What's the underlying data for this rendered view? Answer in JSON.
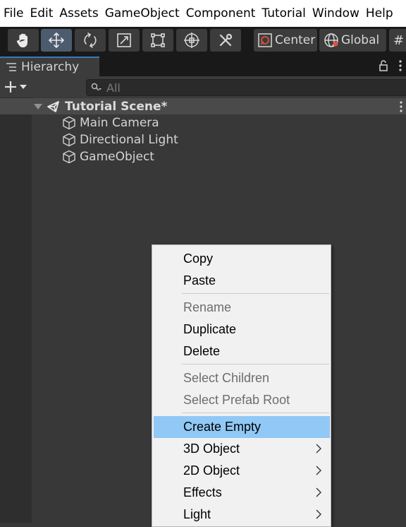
{
  "menubar": {
    "items": [
      "File",
      "Edit",
      "Assets",
      "GameObject",
      "Component",
      "Tutorial",
      "Window",
      "Help"
    ]
  },
  "toolbar": {
    "tools": [
      "hand-tool",
      "move-tool",
      "rotate-tool",
      "scale-tool",
      "rect-tool",
      "transform-tool",
      "custom-tool"
    ],
    "active_tool": "move-tool",
    "pivot_label": "Center",
    "space_label": "Global"
  },
  "hierarchy": {
    "tab_label": "Hierarchy",
    "search_placeholder": "All",
    "scene_name": "Tutorial Scene*",
    "items": [
      "Main Camera",
      "Directional Light",
      "GameObject"
    ]
  },
  "context_menu": {
    "items": [
      {
        "label": "Copy",
        "enabled": true
      },
      {
        "label": "Paste",
        "enabled": true
      },
      {
        "label": "Rename",
        "enabled": false
      },
      {
        "label": "Duplicate",
        "enabled": true
      },
      {
        "label": "Delete",
        "enabled": true
      },
      {
        "label": "Select Children",
        "enabled": false
      },
      {
        "label": "Select Prefab Root",
        "enabled": false
      },
      {
        "label": "Create Empty",
        "enabled": true,
        "highlighted": true
      },
      {
        "label": "3D Object",
        "enabled": true,
        "submenu": true
      },
      {
        "label": "2D Object",
        "enabled": true,
        "submenu": true
      },
      {
        "label": "Effects",
        "enabled": true,
        "submenu": true
      },
      {
        "label": "Light",
        "enabled": true,
        "submenu": true
      }
    ]
  },
  "colors": {
    "highlight": "#90c8f6",
    "tab_accent": "#3a79bb",
    "panel_bg": "#383838"
  }
}
